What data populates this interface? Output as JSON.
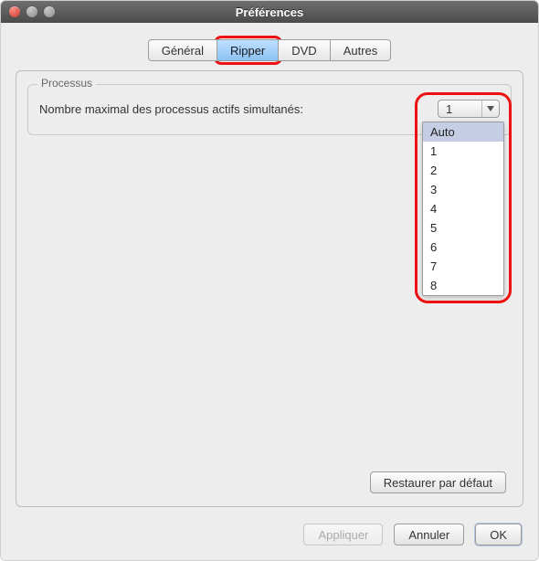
{
  "window": {
    "title": "Préférences"
  },
  "tabs": {
    "items": [
      "Général",
      "Ripper",
      "DVD",
      "Autres"
    ],
    "active_index": 1
  },
  "group": {
    "title": "Processus",
    "label": "Nombre maximal des processus actifs simultanés:",
    "combo_value": "1"
  },
  "dropdown": {
    "items": [
      "Auto",
      "1",
      "2",
      "3",
      "4",
      "5",
      "6",
      "7",
      "8"
    ],
    "selected_index": 0
  },
  "buttons": {
    "restore": "Restaurer par défaut",
    "apply": "Appliquer",
    "cancel": "Annuler",
    "ok": "OK"
  }
}
